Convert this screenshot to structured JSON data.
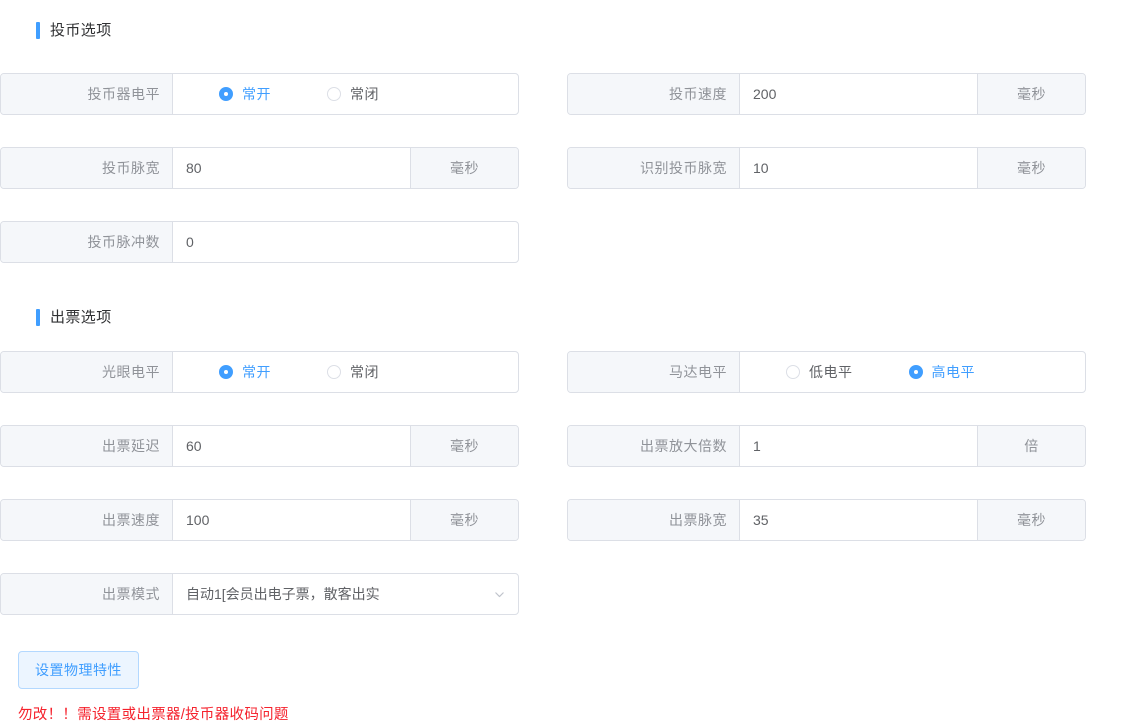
{
  "sections": [
    {
      "title": "投币选项",
      "left_rows": [
        {
          "label": "投币器电平",
          "type": "radio",
          "options": [
            {
              "label": "常开",
              "checked": true
            },
            {
              "label": "常闭",
              "checked": false
            }
          ]
        },
        {
          "label": "投币脉宽",
          "type": "input",
          "value": "80",
          "suffix": "毫秒"
        },
        {
          "label": "投币脉冲数",
          "type": "input",
          "value": "0",
          "suffix": ""
        }
      ],
      "right_rows": [
        {
          "label": "投币速度",
          "type": "input",
          "value": "200",
          "suffix": "毫秒"
        },
        {
          "label": "识别投币脉宽",
          "type": "input",
          "value": "10",
          "suffix": "毫秒"
        }
      ]
    },
    {
      "title": "出票选项",
      "left_rows": [
        {
          "label": "光眼电平",
          "type": "radio",
          "options": [
            {
              "label": "常开",
              "checked": true
            },
            {
              "label": "常闭",
              "checked": false
            }
          ]
        },
        {
          "label": "出票延迟",
          "type": "input",
          "value": "60",
          "suffix": "毫秒"
        },
        {
          "label": "出票速度",
          "type": "input",
          "value": "100",
          "suffix": "毫秒"
        },
        {
          "label": "出票模式",
          "type": "select",
          "value": "自动1[会员出电子票，散客出实",
          "icon": "chevron-down-icon"
        }
      ],
      "right_rows": [
        {
          "label": "马达电平",
          "type": "radio",
          "options": [
            {
              "label": "低电平",
              "checked": false
            },
            {
              "label": "高电平",
              "checked": true
            }
          ]
        },
        {
          "label": "出票放大倍数",
          "type": "input",
          "value": "1",
          "suffix": "倍"
        },
        {
          "label": "出票脉宽",
          "type": "input",
          "value": "35",
          "suffix": "毫秒"
        }
      ]
    }
  ],
  "footer": {
    "button_label": "设置物理特性",
    "note": "勿改！！需设置或出票器/投币器收码问题"
  },
  "colors": {
    "accent": "#409EFF",
    "label_bg": "#f5f7fa",
    "border": "#dcdfe6",
    "text": "#606266",
    "muted": "#909399",
    "warning": "#f5222d",
    "button_bg": "#ecf5ff",
    "button_border": "#b3d8ff"
  }
}
